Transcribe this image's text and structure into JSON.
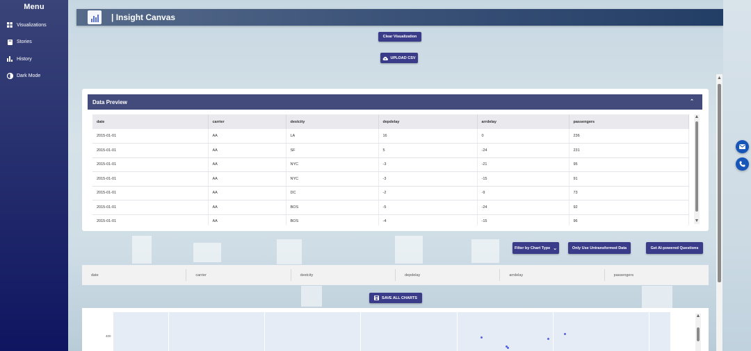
{
  "sidebar": {
    "title": "Menu",
    "items": [
      {
        "label": "Visualizations",
        "icon": "grid-icon"
      },
      {
        "label": "Stories",
        "icon": "book-icon"
      },
      {
        "label": "History",
        "icon": "bar-chart-icon"
      },
      {
        "label": "Dark Mode",
        "icon": "contrast-icon"
      }
    ]
  },
  "header": {
    "title": "| Insight Canvas",
    "logo": "chart-logo-icon"
  },
  "actions": {
    "clear_label": "Clear Visualization",
    "upload_label": "UPLOAD CSV",
    "filter_label": "Filter by Chart Type",
    "untransformed_label": "Only Use Untransformed Data",
    "ai_label": "Get AI-powered Questions",
    "save_all_label": "SAVE ALL CHARTS"
  },
  "preview": {
    "title": "Data Preview",
    "columns": [
      "date",
      "carrier",
      "destcity",
      "depdelay",
      "arrdelay",
      "passengers"
    ],
    "rows": [
      [
        "2015-01-01",
        "AA",
        "LA",
        "16",
        "0",
        "236"
      ],
      [
        "2015-01-01",
        "AA",
        "SF",
        "5",
        "-24",
        "231"
      ],
      [
        "2015-01-01",
        "AA",
        "NYC",
        "-3",
        "-21",
        "95"
      ],
      [
        "2015-01-01",
        "AA",
        "NYC",
        "-3",
        "-15",
        "91"
      ],
      [
        "2015-01-01",
        "AA",
        "DC",
        "-2",
        "-9",
        "73"
      ],
      [
        "2015-01-01",
        "AA",
        "BOS",
        "-5",
        "-24",
        "92"
      ],
      [
        "2015-01-01",
        "AA",
        "BOS",
        "-4",
        "-15",
        "96"
      ]
    ]
  },
  "column_selector": [
    "date",
    "carrier",
    "destcity",
    "depdelay",
    "arrdelay",
    "passengers"
  ],
  "chart": {
    "ytick": "400"
  },
  "colors": {
    "accent": "#3a3c8a",
    "header": "#434a7c",
    "fab": "#1556b8",
    "point": "#5563e0"
  }
}
